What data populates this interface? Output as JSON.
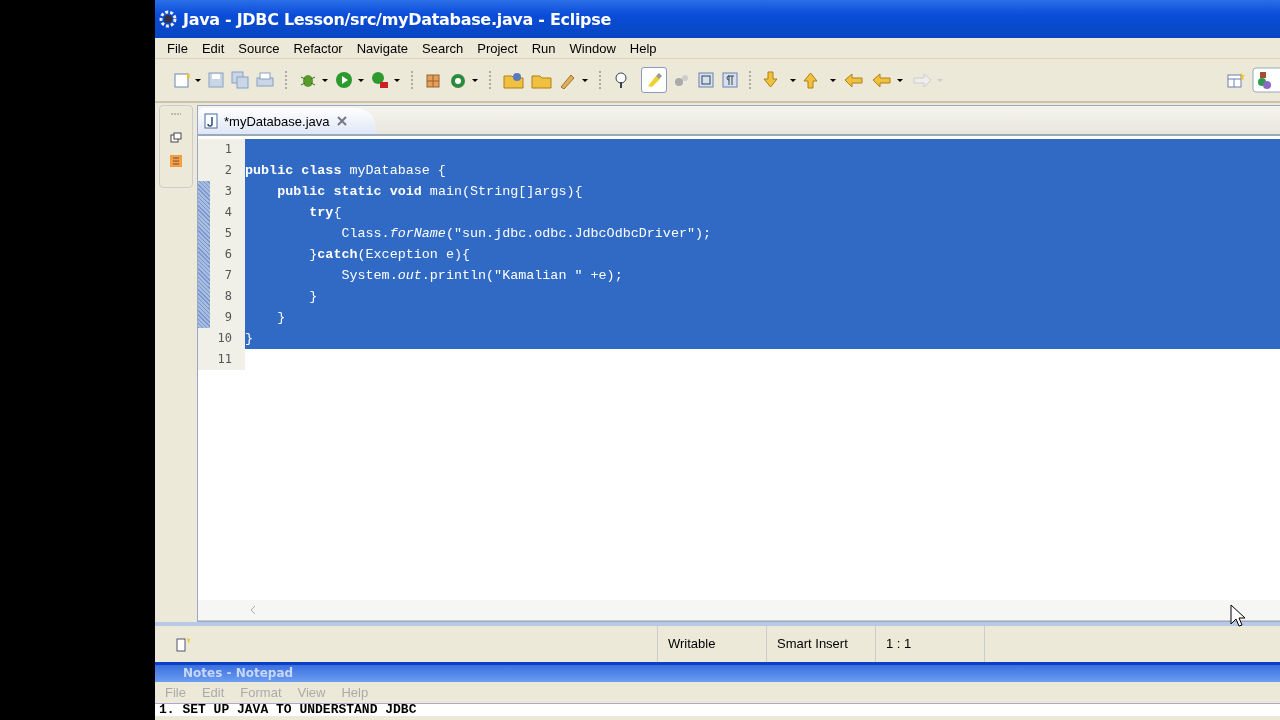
{
  "window": {
    "title": "Java - JDBC Lesson/src/myDatabase.java - Eclipse"
  },
  "menu": [
    "File",
    "Edit",
    "Source",
    "Refactor",
    "Navigate",
    "Search",
    "Project",
    "Run",
    "Window",
    "Help"
  ],
  "toolbar": {
    "highlight_pressed": true
  },
  "editor_tab": {
    "label": "*myDatabase.java",
    "selected": true
  },
  "code_lines": [
    {
      "number": "1",
      "selected": true,
      "changed": false
    },
    {
      "number": "2",
      "text": "**public class** myDatabase {",
      "selected": true,
      "changed": false
    },
    {
      "number": "3",
      "text": "    **public static void** main(String[]args){",
      "selected": true,
      "changed": true
    },
    {
      "number": "4",
      "text": "        **try**{",
      "selected": true,
      "changed": true
    },
    {
      "number": "5",
      "text": "            Class.*forName*(\"sun.jdbc.odbc.JdbcOdbcDriver\");",
      "selected": true,
      "changed": true
    },
    {
      "number": "6",
      "text": "        }**catch**(Exception e){",
      "selected": true,
      "changed": true
    },
    {
      "number": "7",
      "text": "            System.*out*.println(\"Kamalian \" +e);",
      "selected": true,
      "changed": true
    },
    {
      "number": "8",
      "text": "        }",
      "selected": true,
      "changed": true
    },
    {
      "number": "9",
      "text": "    }",
      "selected": true,
      "changed": true
    },
    {
      "number": "10",
      "text": "}",
      "selected": true,
      "changed": false
    },
    {
      "number": "11",
      "selected": false,
      "changed": false
    }
  ],
  "status_bar": [
    "Writable",
    "Smart Insert",
    "1 : 1"
  ],
  "notepad": {
    "title": "Notes - Notepad",
    "menu": [
      "File",
      "Edit",
      "Format",
      "View",
      "Help"
    ],
    "text": "1. SET UP JAVA TO UNDERSTAND JDBC"
  }
}
